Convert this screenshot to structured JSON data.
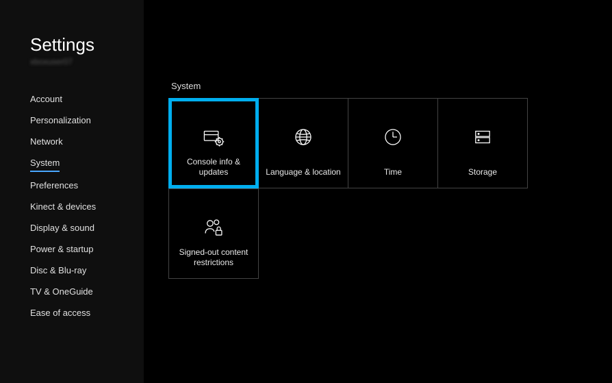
{
  "sidebar": {
    "title": "Settings",
    "subtitle": "xboxuser07",
    "items": [
      {
        "label": "Account",
        "active": false
      },
      {
        "label": "Personalization",
        "active": false
      },
      {
        "label": "Network",
        "active": false
      },
      {
        "label": "System",
        "active": true
      },
      {
        "label": "Preferences",
        "active": false
      },
      {
        "label": "Kinect & devices",
        "active": false
      },
      {
        "label": "Display & sound",
        "active": false
      },
      {
        "label": "Power & startup",
        "active": false
      },
      {
        "label": "Disc & Blu-ray",
        "active": false
      },
      {
        "label": "TV & OneGuide",
        "active": false
      },
      {
        "label": "Ease of access",
        "active": false
      }
    ]
  },
  "main": {
    "section_title": "System",
    "tiles": [
      {
        "label": "Console info & updates",
        "icon": "console-gear-icon",
        "selected": true
      },
      {
        "label": "Language & location",
        "icon": "globe-icon",
        "selected": false
      },
      {
        "label": "Time",
        "icon": "clock-icon",
        "selected": false
      },
      {
        "label": "Storage",
        "icon": "storage-icon",
        "selected": false
      },
      {
        "label": "Signed-out content restrictions",
        "icon": "people-lock-icon",
        "selected": false
      }
    ]
  }
}
